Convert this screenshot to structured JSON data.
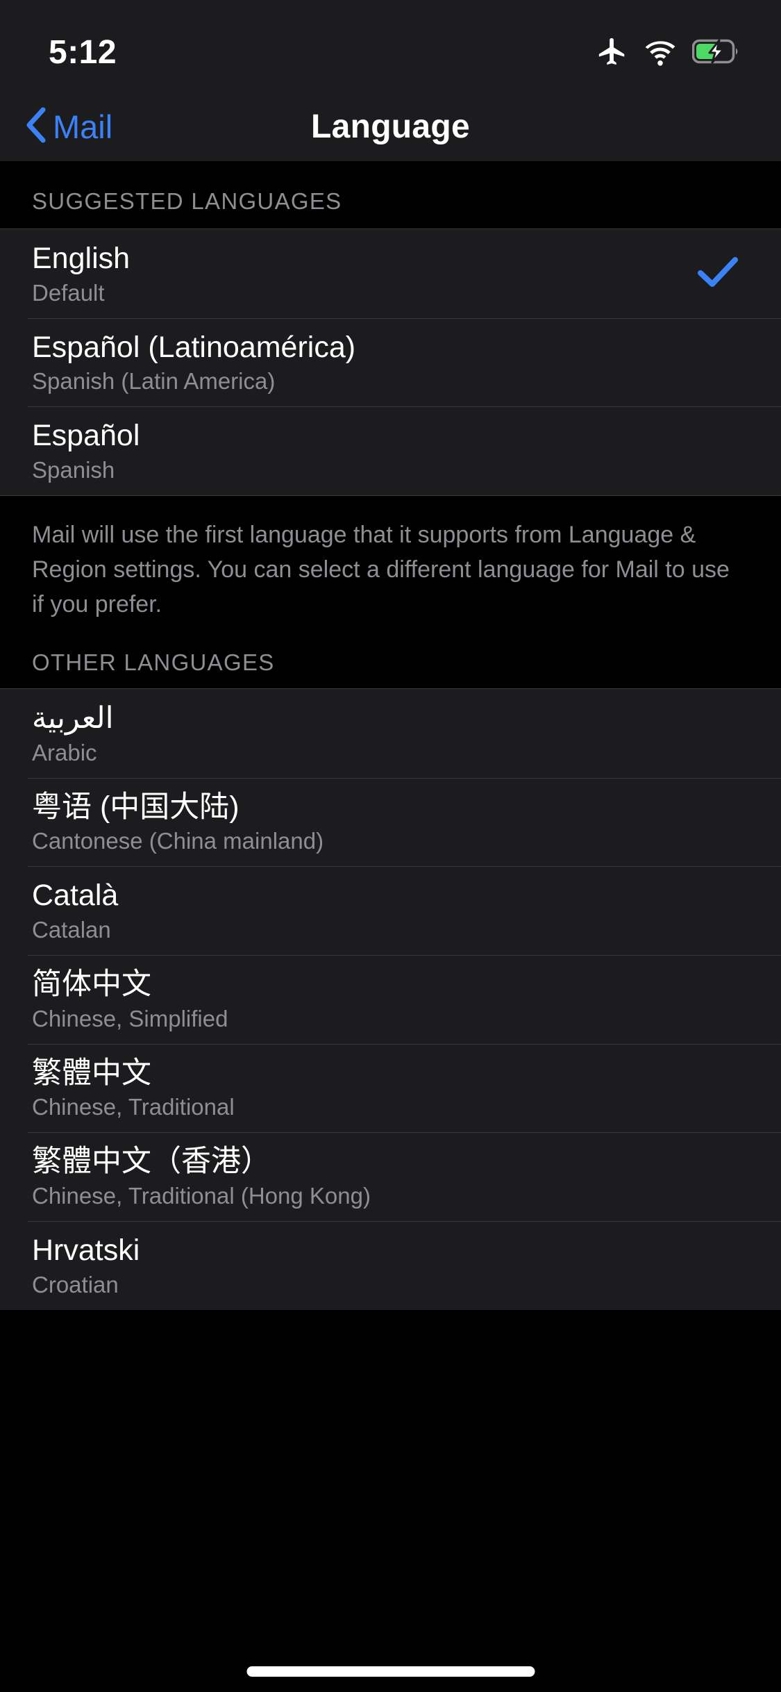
{
  "status_bar": {
    "time": "5:12",
    "icons": [
      "airplane-mode-icon",
      "wifi-icon",
      "battery-charging-icon"
    ],
    "battery_level_percent": 58,
    "battery_fill_color": "#4CD964"
  },
  "nav_bar": {
    "back_label": "Mail",
    "back_icon": "chevron-left-icon",
    "title": "Language",
    "accent_color": "#3B82F6"
  },
  "suggested": {
    "header": "SUGGESTED LANGUAGES",
    "items": [
      {
        "title": "English",
        "subtitle": "Default",
        "selected": true
      },
      {
        "title": "Español (Latinoamérica)",
        "subtitle": "Spanish (Latin America)",
        "selected": false
      },
      {
        "title": "Español",
        "subtitle": "Spanish",
        "selected": false
      }
    ],
    "footer": "Mail will use the first language that it supports from Language & Region settings. You can select a different language for Mail to use if you prefer."
  },
  "other": {
    "header": "OTHER LANGUAGES",
    "items": [
      {
        "title": "العربية",
        "subtitle": "Arabic",
        "selected": false
      },
      {
        "title": "粤语 (中国大陆)",
        "subtitle": "Cantonese (China mainland)",
        "selected": false
      },
      {
        "title": "Català",
        "subtitle": "Catalan",
        "selected": false
      },
      {
        "title": "简体中文",
        "subtitle": "Chinese, Simplified",
        "selected": false
      },
      {
        "title": "繁體中文",
        "subtitle": "Chinese, Traditional",
        "selected": false
      },
      {
        "title": "繁體中文（香港）",
        "subtitle": "Chinese, Traditional (Hong Kong)",
        "selected": false
      },
      {
        "title": "Hrvatski",
        "subtitle": "Croatian",
        "selected": false
      }
    ]
  },
  "home_indicator": {
    "name": "home-indicator"
  }
}
